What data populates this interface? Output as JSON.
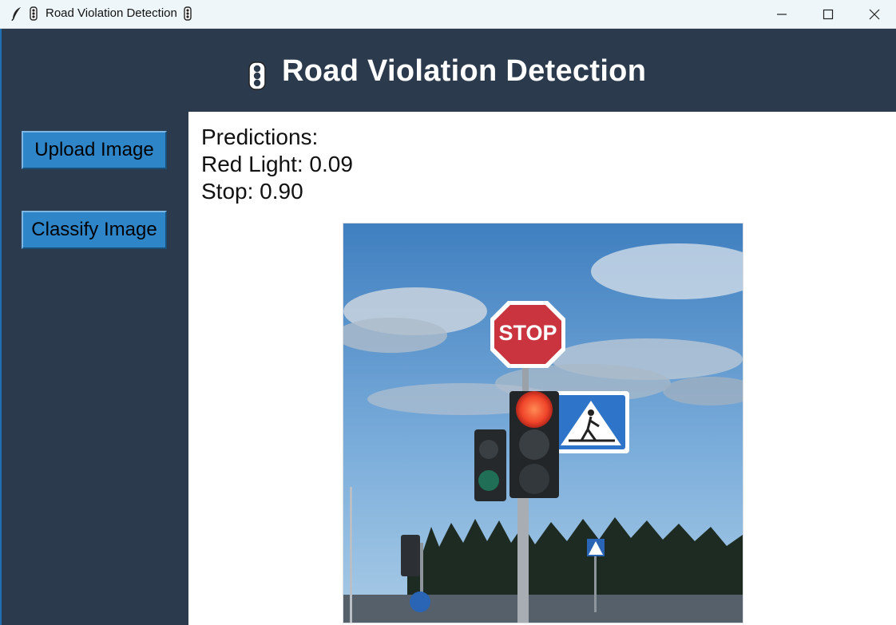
{
  "window": {
    "title": "Road Violation Detection"
  },
  "header": {
    "title": "Road Violation Detection",
    "icon": "traffic-light-icon"
  },
  "sidebar": {
    "buttons": [
      {
        "label": "Upload Image"
      },
      {
        "label": "Classify Image"
      }
    ]
  },
  "predictions": {
    "heading": "Predictions:",
    "lines": [
      "Red Light: 0.09",
      "Stop: 0.90"
    ]
  },
  "photo": {
    "sign_text": "STOP"
  },
  "colors": {
    "panel_bg": "#2b3a4c",
    "button_bg": "#2e86c9",
    "content_bg": "#ffffff"
  }
}
